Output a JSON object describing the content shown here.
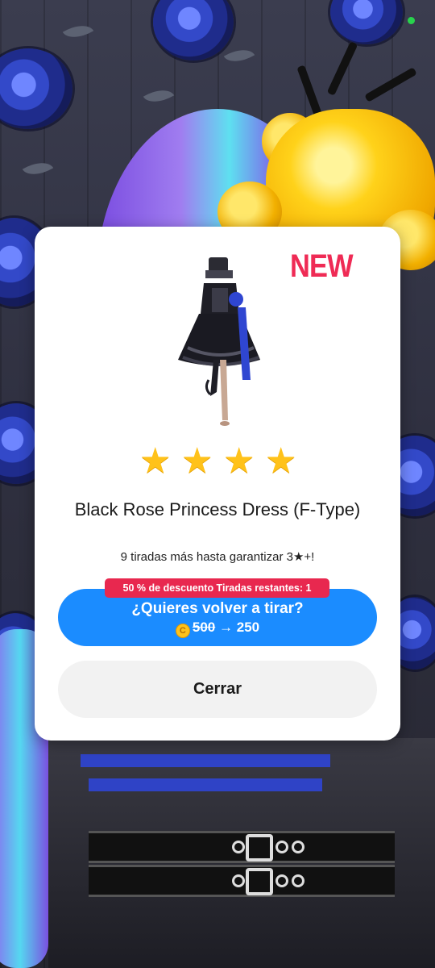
{
  "dialog": {
    "badge": "NEW",
    "star_count": 4,
    "star_glyph": "★",
    "item_name": "Black Rose Princess Dress (F-Type)",
    "pity_text": "9 tiradas más hasta garantizar 3★+!",
    "discount_tag": "50 % de descuento Tiradas restantes: 1",
    "reroll": {
      "label": "¿Quieres volver a tirar?",
      "coin_glyph": "C",
      "old_price": "500",
      "arrow": "→",
      "new_price": "250"
    },
    "close_label": "Cerrar"
  },
  "colors": {
    "new_badge": "#ef2b55",
    "star": "#ffc21a",
    "reroll_button": "#1b8cff",
    "discount_tag": "#e8284f",
    "close_button": "#f2f2f2",
    "status_dot": "#28d34d"
  }
}
